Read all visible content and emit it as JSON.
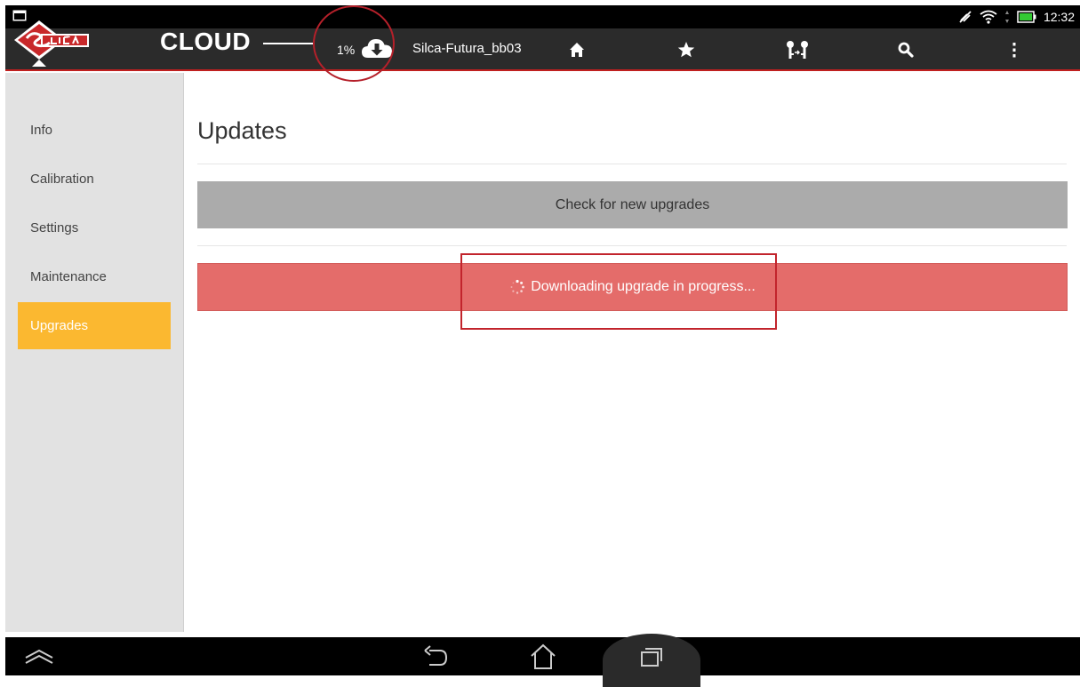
{
  "status": {
    "time": "12:32"
  },
  "appbar": {
    "annotation_label": "CLOUD",
    "download_percent": "1%",
    "device_name": "Silca-Futura_bb03"
  },
  "icons": {
    "logo": "silca-logo",
    "download": "cloud-download-icon",
    "home": "home-icon",
    "favorites": "star-icon",
    "keys": "keys-icon",
    "search": "search-icon",
    "menu": "overflow-menu-icon"
  },
  "sidebar": {
    "items": [
      {
        "label": "Info"
      },
      {
        "label": "Calibration"
      },
      {
        "label": "Settings"
      },
      {
        "label": "Maintenance"
      },
      {
        "label": "Upgrades"
      }
    ],
    "active_index": 4
  },
  "main": {
    "title": "Updates",
    "check_button_label": "Check for new upgrades",
    "progress_text": "Downloading upgrade in progress..."
  },
  "colors": {
    "accent": "#fbb830",
    "appbar": "#2b2b2b",
    "progress": "#e46c6a",
    "annotation": "#c2242c"
  }
}
